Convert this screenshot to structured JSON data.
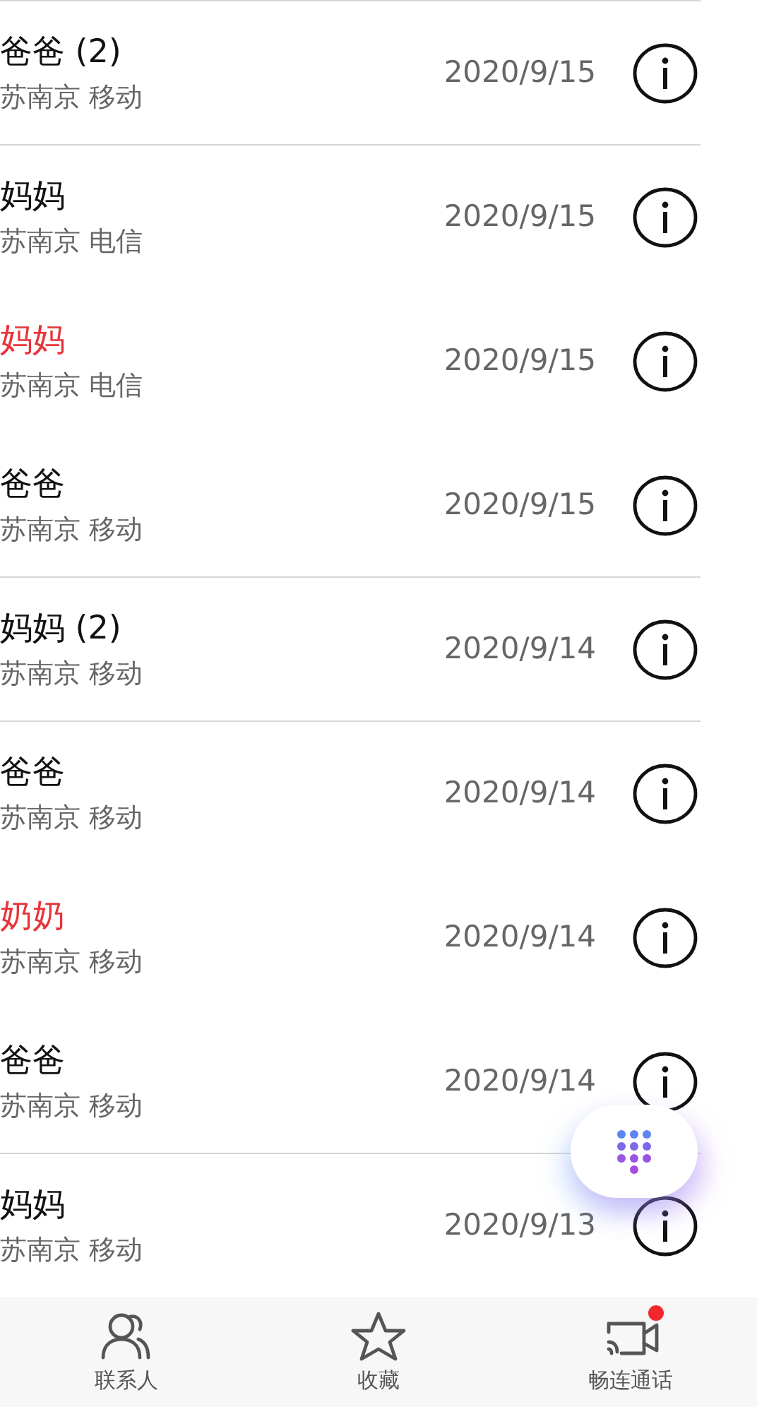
{
  "calls": [
    {
      "name": "爸爸 (2)",
      "location": "苏南京 移动",
      "date": "2020/9/15",
      "missed": false,
      "divider_above": true
    },
    {
      "name": "妈妈",
      "location": "苏南京 电信",
      "date": "2020/9/15",
      "missed": false,
      "divider_above": true
    },
    {
      "name": "妈妈",
      "location": "苏南京 电信",
      "date": "2020/9/15",
      "missed": true,
      "divider_above": false
    },
    {
      "name": "爸爸",
      "location": "苏南京 移动",
      "date": "2020/9/15",
      "missed": false,
      "divider_above": false
    },
    {
      "name": "妈妈 (2)",
      "location": "苏南京 移动",
      "date": "2020/9/14",
      "missed": false,
      "divider_above": true
    },
    {
      "name": "爸爸",
      "location": "苏南京 移动",
      "date": "2020/9/14",
      "missed": false,
      "divider_above": true
    },
    {
      "name": "奶奶",
      "location": "苏南京 移动",
      "date": "2020/9/14",
      "missed": true,
      "divider_above": false
    },
    {
      "name": "爸爸",
      "location": "苏南京 移动",
      "date": "2020/9/14",
      "missed": false,
      "divider_above": false
    },
    {
      "name": "妈妈",
      "location": "苏南京 移动",
      "date": "2020/9/13",
      "missed": false,
      "divider_above": true
    }
  ],
  "bottom_nav": [
    {
      "kind": "contacts",
      "label": "联系人",
      "badge": false
    },
    {
      "kind": "favorites",
      "label": "收藏",
      "badge": false
    },
    {
      "kind": "video",
      "label": "畅连通话",
      "badge": true
    }
  ]
}
